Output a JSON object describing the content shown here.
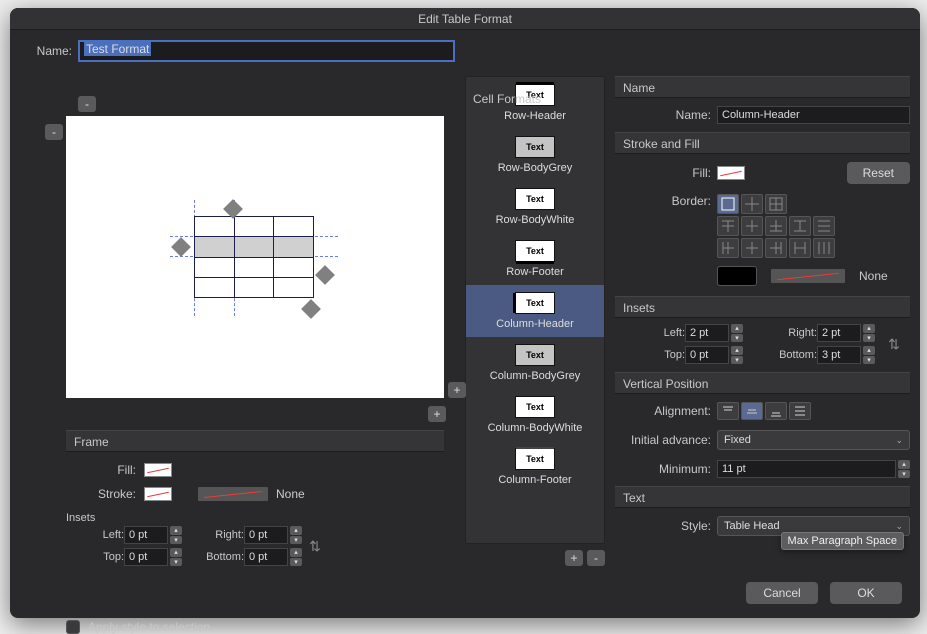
{
  "title": "Edit Table Format",
  "name_label": "Name:",
  "name_value": "Test Format",
  "frame": {
    "header": "Frame",
    "fill_label": "Fill:",
    "stroke_label": "Stroke:",
    "stroke_value": "None",
    "insets_header": "Insets",
    "left_label": "Left:",
    "left_value": "0 pt",
    "right_label": "Right:",
    "right_value": "0 pt",
    "top_label": "Top:",
    "top_value": "0 pt",
    "bottom_label": "Bottom:",
    "bottom_value": "0 pt"
  },
  "apply_label": "Apply style to selection",
  "cell_formats": {
    "header": "Cell Formats",
    "items": [
      {
        "label": "Row-Header",
        "thumb": "topbar"
      },
      {
        "label": "Row-BodyGrey",
        "thumb": "grey"
      },
      {
        "label": "Row-BodyWhite",
        "thumb": ""
      },
      {
        "label": "Row-Footer",
        "thumb": "botbar"
      },
      {
        "label": "Column-Header",
        "thumb": "leftbar",
        "selected": true
      },
      {
        "label": "Column-BodyGrey",
        "thumb": "grey"
      },
      {
        "label": "Column-BodyWhite",
        "thumb": ""
      },
      {
        "label": "Column-Footer",
        "thumb": "topbar2"
      }
    ]
  },
  "right": {
    "name_header": "Name",
    "name_label": "Name:",
    "name_value": "Column-Header",
    "stroke_header": "Stroke and Fill",
    "fill_label": "Fill:",
    "reset_label": "Reset",
    "border_label": "Border:",
    "stroke_value": "None",
    "insets_header": "Insets",
    "left_label": "Left:",
    "left_value": "2 pt",
    "right_label": "Right:",
    "right_value": "2 pt",
    "top_label": "Top:",
    "top_value": "0 pt",
    "bottom_label": "Bottom:",
    "bottom_value": "3 pt",
    "vpos_header": "Vertical Position",
    "align_label": "Alignment:",
    "initadv_label": "Initial advance:",
    "initadv_value": "Fixed",
    "minimum_label": "Minimum:",
    "minimum_value": "11 pt",
    "text_header": "Text",
    "style_label": "Style:",
    "style_value": "Table Head",
    "tooltip": "Max Paragraph Space"
  },
  "buttons": {
    "cancel": "Cancel",
    "ok": "OK"
  },
  "thumb_text": "Text"
}
